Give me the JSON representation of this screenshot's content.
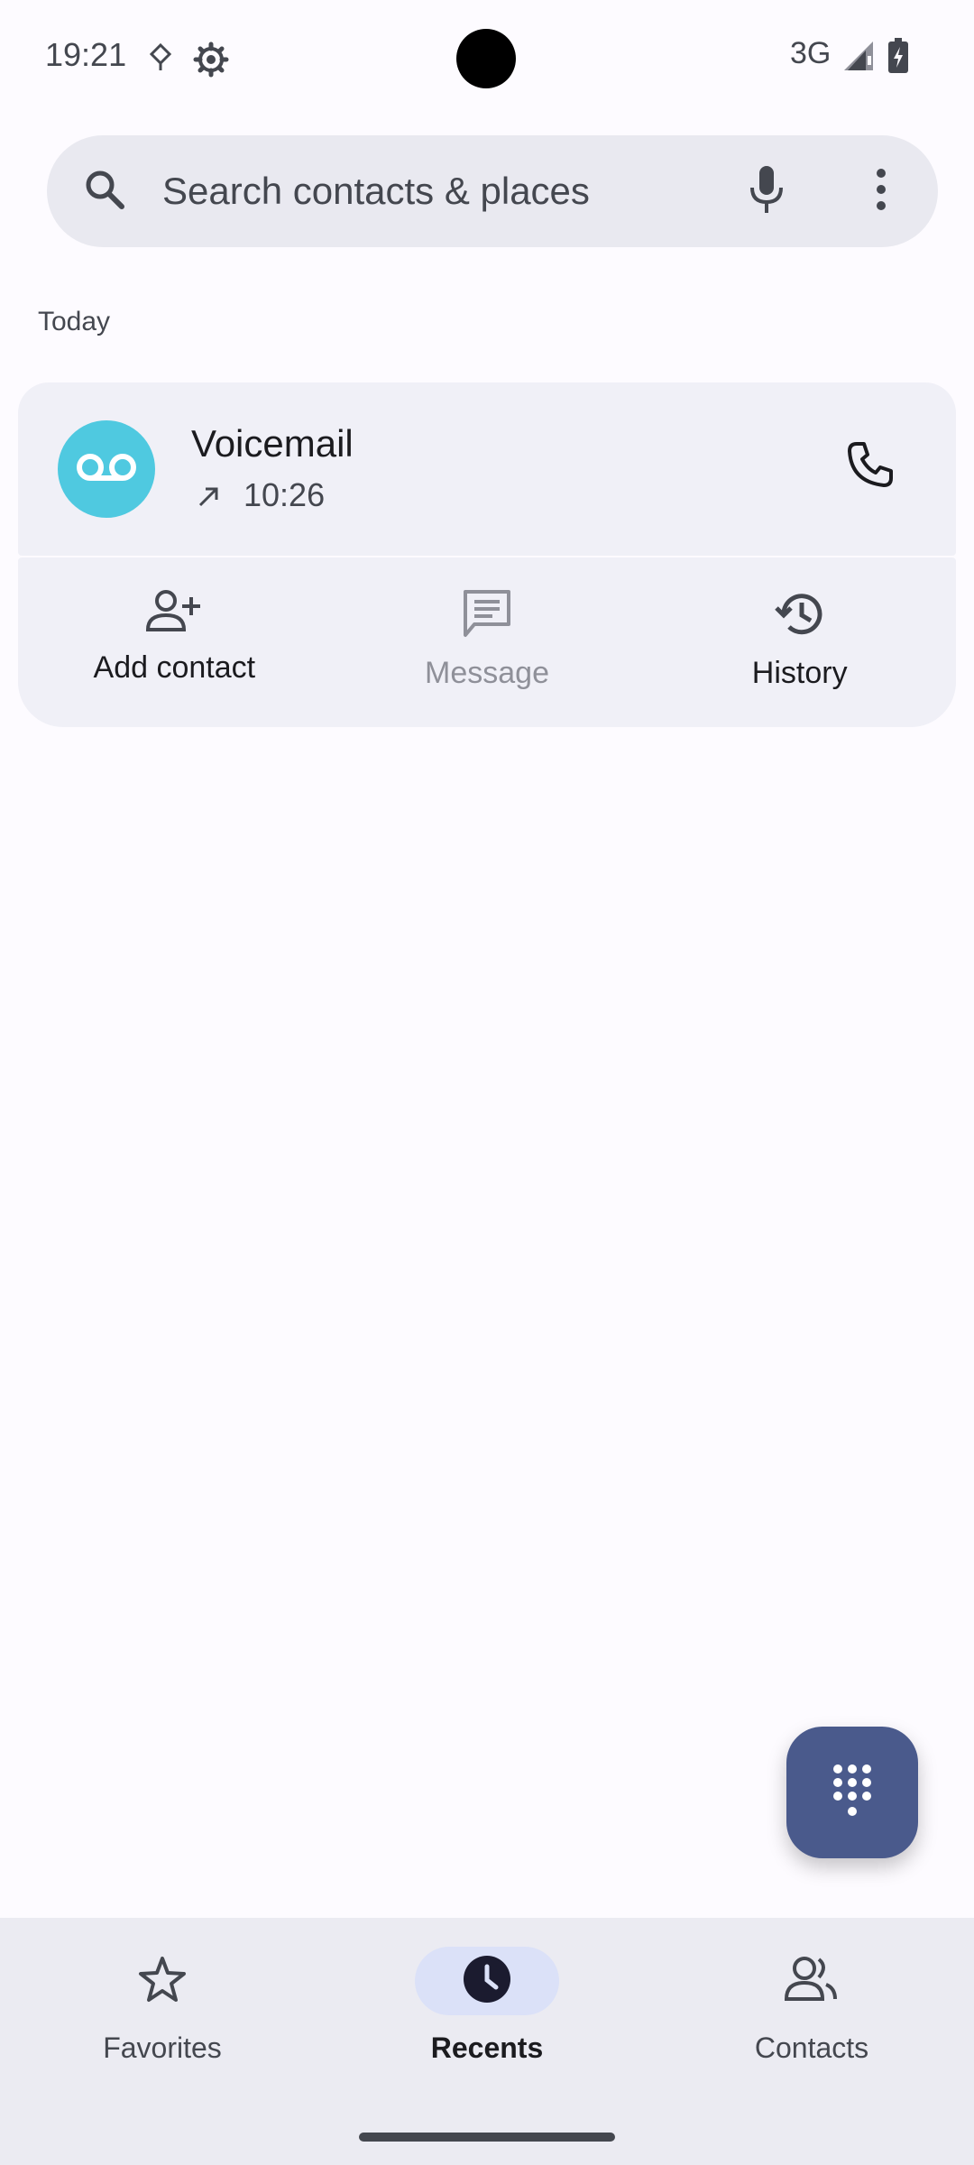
{
  "status_bar": {
    "time": "19:21",
    "network": "3G",
    "icons": [
      "data-saver-icon",
      "settings-gear-icon",
      "signal-icon",
      "battery-charging-icon"
    ]
  },
  "search": {
    "placeholder": "Search contacts & places",
    "icons": [
      "search-icon",
      "mic-icon",
      "more-vert-icon"
    ]
  },
  "call_log": {
    "section_header": "Today",
    "entries": [
      {
        "name": "Voicemail",
        "time": "10:26",
        "avatar_icon": "voicemail-icon",
        "avatar_color": "#4fc9e0",
        "direction_icon": "outgoing-call-icon",
        "action_icon": "phone-icon"
      }
    ],
    "actions": [
      {
        "label": "Add contact",
        "icon": "add-person-icon",
        "enabled": true
      },
      {
        "label": "Message",
        "icon": "message-icon",
        "enabled": false
      },
      {
        "label": "History",
        "icon": "history-icon",
        "enabled": true
      }
    ]
  },
  "fab": {
    "icon": "dialpad-icon",
    "color": "#4a5a8c"
  },
  "bottom_nav": {
    "items": [
      {
        "label": "Favorites",
        "icon": "star-icon",
        "active": false
      },
      {
        "label": "Recents",
        "icon": "clock-icon",
        "active": true
      },
      {
        "label": "Contacts",
        "icon": "contacts-icon",
        "active": false
      }
    ]
  },
  "colors": {
    "background": "#fdfbff",
    "surface": "#f0f0f7",
    "nav_active_pill": "#dbe1f8"
  }
}
